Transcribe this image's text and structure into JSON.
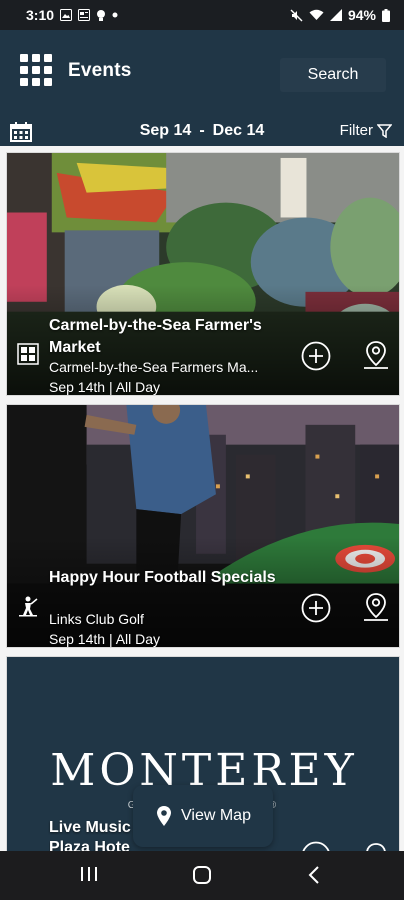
{
  "status_bar": {
    "time": "3:10",
    "battery": "94%"
  },
  "header": {
    "title": "Events",
    "search_label": "Search"
  },
  "date_filter": {
    "start": "Sep 14",
    "separator": "-",
    "end": "Dec 14",
    "filter_label": "Filter"
  },
  "events": [
    {
      "title": "Carmel-by-the-Sea Farmer's Market",
      "venue": "Carmel-by-the-Sea Farmers Ma...",
      "date": "Sep 14th | All Day"
    },
    {
      "title": "Happy Hour Football Specials",
      "venue": "Links Club Golf",
      "date": "Sep 14th | All Day"
    },
    {
      "title": "Live Music",
      "venue": "Plaza Hote",
      "logo_word": "MONTEREY",
      "logo_tagline": "GRAB LI                  OMENTS®"
    }
  ],
  "view_map_label": "View Map",
  "colors": {
    "primary": "#203646",
    "accent": "#273c4c"
  }
}
